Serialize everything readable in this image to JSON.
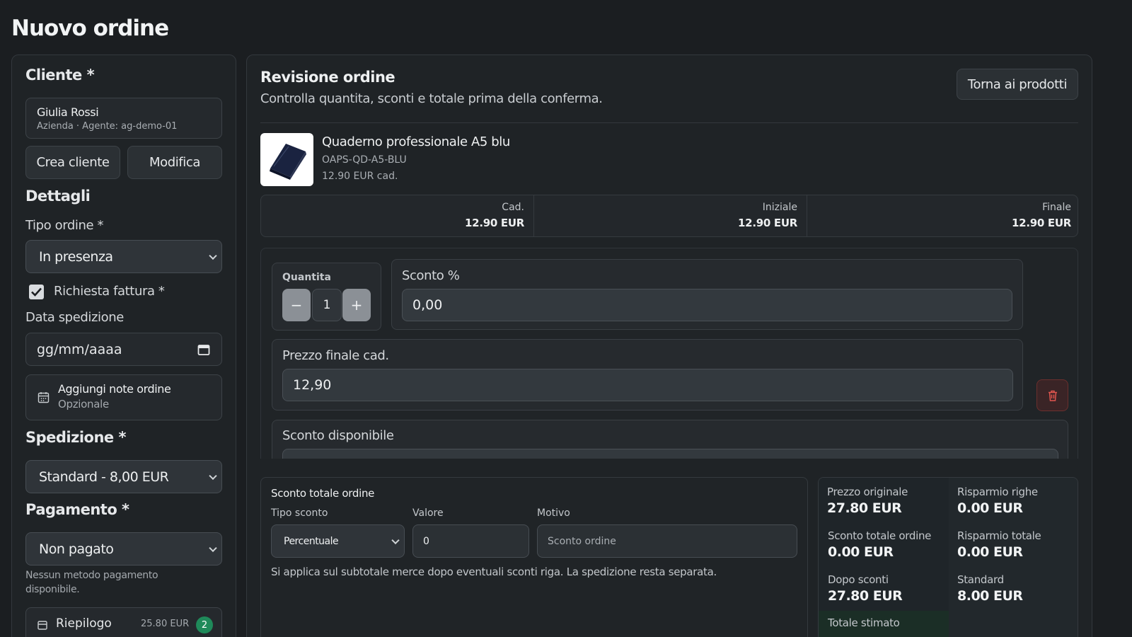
{
  "page": {
    "title": "Nuovo ordine"
  },
  "customer": {
    "heading": "Cliente *",
    "name": "Giulia Rossi",
    "meta": "Azienda · Agente: ag-demo-01",
    "create_label": "Crea cliente",
    "edit_label": "Modifica"
  },
  "details": {
    "heading": "Dettagli",
    "order_type_label": "Tipo ordine *",
    "order_type_value": "In presenza",
    "invoice_label": "Richiesta fattura *",
    "invoice_checked": true,
    "ship_date_label": "Data spedizione",
    "ship_date_placeholder": "gg/mm/aaaa",
    "notes_title": "Aggiungi note ordine",
    "notes_sub": "Opzionale"
  },
  "shipping": {
    "heading": "Spedizione *",
    "value": "Standard - 8,00 EUR"
  },
  "payment": {
    "heading": "Pagamento *",
    "value": "Non pagato",
    "note": "Nessun metodo pagamento disponibile.",
    "cart_label": "Riepilogo",
    "cart_total": "25.80 EUR",
    "cart_count": "2"
  },
  "review": {
    "title": "Revisione ordine",
    "subtitle": "Controlla quantita, sconti e totale prima della conferma.",
    "back_label": "Torna ai prodotti"
  },
  "item": {
    "name": "Quaderno professionale A5 blu",
    "sku": "OAPS-QD-A5-BLU",
    "unit_price": "12.90 EUR cad.",
    "cols": [
      {
        "label": "Cad.",
        "value": "12.90 EUR"
      },
      {
        "label": "Iniziale",
        "value": "12.90 EUR"
      },
      {
        "label": "Finale",
        "value": "12.90 EUR"
      }
    ],
    "qty_label": "Quantita",
    "qty_value": "1",
    "discount_label": "Sconto %",
    "discount_value": "0,00",
    "final_price_label": "Prezzo finale cad.",
    "final_price_value": "12,90",
    "avail_discount_label": "Sconto disponibile"
  },
  "order_discount": {
    "title": "Sconto totale ordine",
    "type_label": "Tipo sconto",
    "type_value": "Percentuale",
    "value_label": "Valore",
    "value_value": "0",
    "reason_label": "Motivo",
    "reason_placeholder": "Sconto ordine",
    "note": "Si applica sul subtotale merce dopo eventuali sconti riga. La spedizione resta separata."
  },
  "summary": {
    "items": [
      {
        "label": "Prezzo originale",
        "value": "27.80 EUR"
      },
      {
        "label": "Risparmio righe",
        "value": "0.00 EUR"
      },
      {
        "label": "Sconto totale ordine",
        "value": "0.00 EUR"
      },
      {
        "label": "Risparmio totale",
        "value": "0.00 EUR"
      },
      {
        "label": "Dopo sconti",
        "value": "27.80 EUR"
      },
      {
        "label": "Standard",
        "value": "8.00 EUR"
      }
    ],
    "total_label": "Totale stimato"
  },
  "colors": {
    "accent": "#1f8a5a",
    "danger": "#d0453f",
    "background": "#1b1e21"
  }
}
